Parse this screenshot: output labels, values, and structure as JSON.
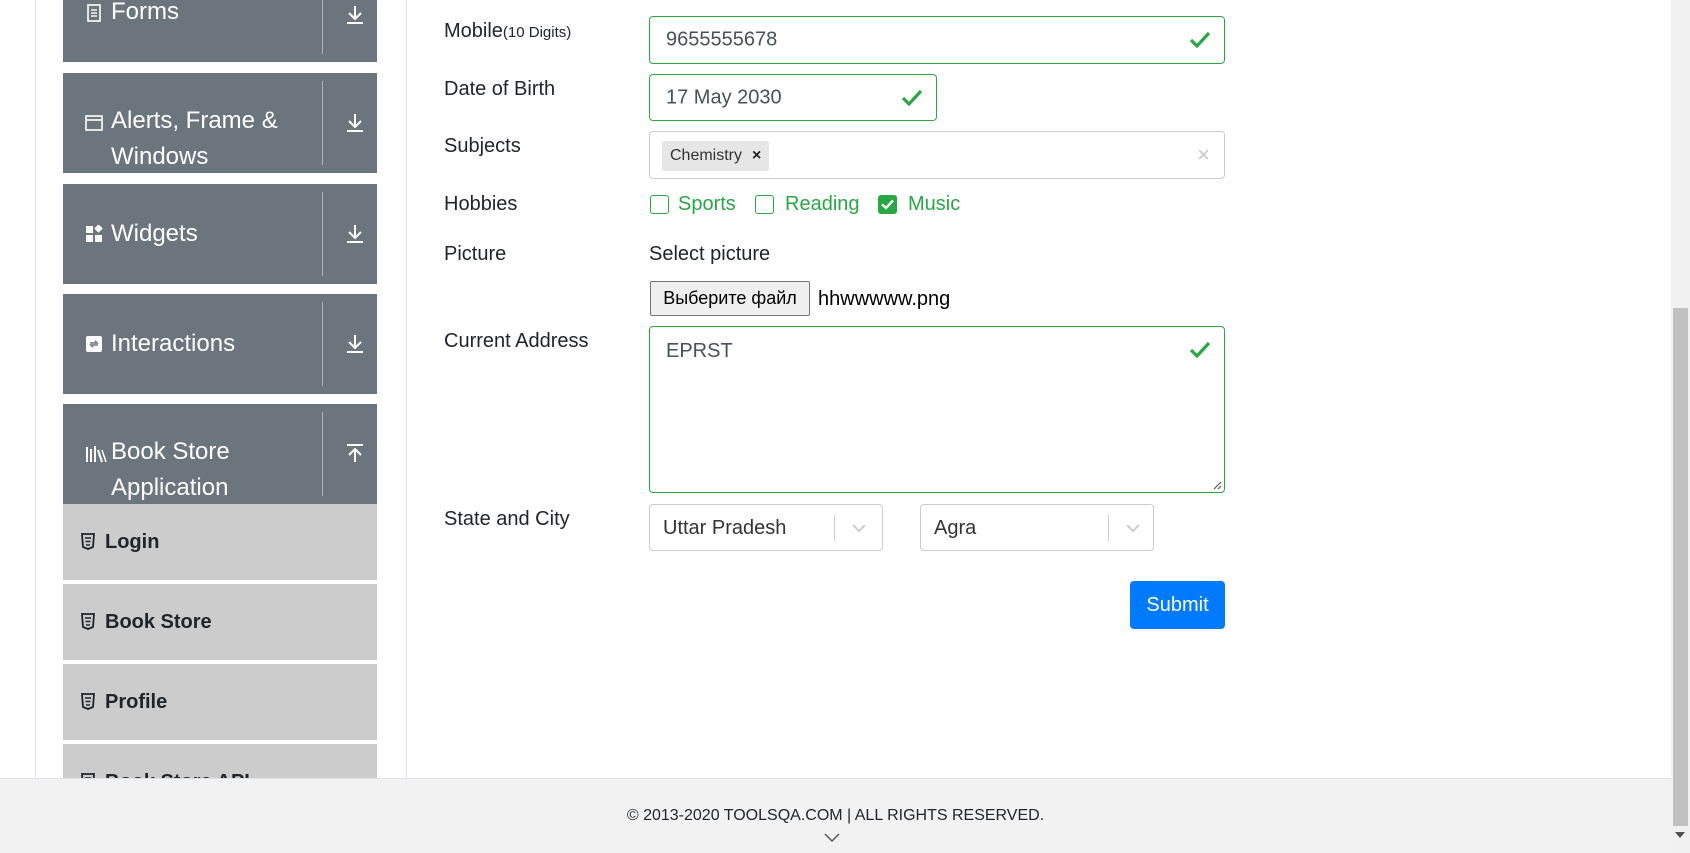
{
  "sidebar": {
    "groups": [
      {
        "label": "Forms",
        "icon": "form-icon",
        "arrow": "download-arrow-icon"
      },
      {
        "label_line1": "Alerts, Frame &",
        "label_line2": "Windows",
        "icon": "window-icon",
        "arrow": "download-arrow-icon"
      },
      {
        "label": "Widgets",
        "icon": "widgets-icon",
        "arrow": "download-arrow-icon"
      },
      {
        "label": "Interactions",
        "icon": "interactions-icon",
        "arrow": "download-arrow-icon"
      },
      {
        "label_line1": "Book Store",
        "label_line2": "Application",
        "icon": "books-icon",
        "arrow": "upload-arrow-icon"
      }
    ],
    "book_store_items": [
      {
        "label": "Login",
        "icon": "html5-icon"
      },
      {
        "label": "Book Store",
        "icon": "html5-icon"
      },
      {
        "label": "Profile",
        "icon": "html5-icon"
      },
      {
        "label": "Book Store API",
        "icon": "html5-icon"
      }
    ]
  },
  "form": {
    "mobile": {
      "label": "Mobile",
      "hint": "(10 Digits)",
      "value": "9655555678"
    },
    "dob": {
      "label": "Date of Birth",
      "value": "17 May 2030"
    },
    "subjects": {
      "label": "Subjects",
      "chips": [
        "Chemistry"
      ],
      "chip_remove": "×",
      "clear": "×"
    },
    "hobbies": {
      "label": "Hobbies",
      "options": [
        {
          "label": "Sports",
          "checked": false
        },
        {
          "label": "Reading",
          "checked": false
        },
        {
          "label": "Music",
          "checked": true
        }
      ]
    },
    "picture": {
      "label": "Picture",
      "prompt": "Select picture",
      "button": "Выберите файл",
      "filename": "hhwwwww.png"
    },
    "address": {
      "label": "Current Address",
      "value": "EPRST"
    },
    "state_city": {
      "label": "State and City",
      "state": "Uttar Pradesh",
      "city": "Agra"
    },
    "submit": "Submit"
  },
  "footer": {
    "text": "© 2013-2020 TOOLSQA.COM | ALL RIGHTS RESERVED."
  },
  "colors": {
    "valid": "#28a745",
    "primary": "#007bff",
    "sidebar": "#6c757d",
    "subitem": "#cccccc"
  }
}
